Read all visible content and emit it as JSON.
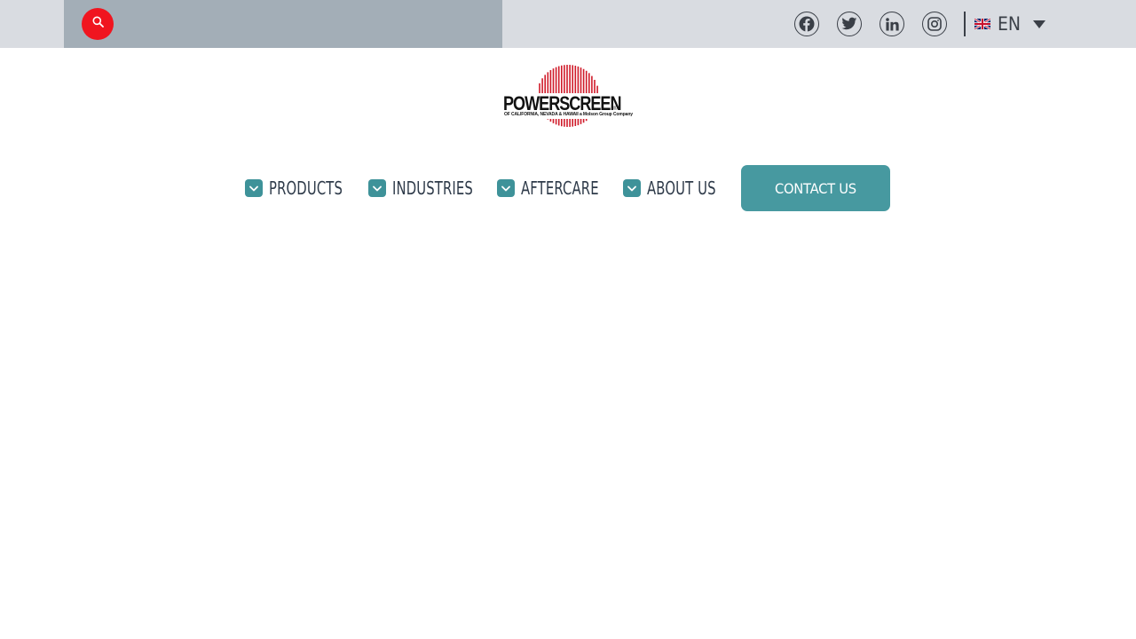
{
  "topbar": {
    "search": {
      "icon": "search-icon",
      "color": "#f0151f"
    },
    "social": [
      {
        "name": "facebook",
        "icon": "facebook-icon"
      },
      {
        "name": "twitter",
        "icon": "twitter-icon"
      },
      {
        "name": "linkedin",
        "icon": "linkedin-icon"
      },
      {
        "name": "instagram",
        "icon": "instagram-icon"
      }
    ],
    "language": {
      "flag_icon": "uk-flag-icon",
      "code": "EN",
      "caret_icon": "caret-down-icon"
    }
  },
  "logo": {
    "title": "POWERSCREEN",
    "registered": "®",
    "subtitle": "OF CALIFORNIA, NEVADA & HAWAII a Molson Group Company",
    "accent": "#d01b2a"
  },
  "nav": {
    "items": [
      {
        "label": "PRODUCTS",
        "icon": "chevron-down-icon"
      },
      {
        "label": "INDUSTRIES",
        "icon": "chevron-down-icon"
      },
      {
        "label": "AFTERCARE",
        "icon": "chevron-down-icon"
      },
      {
        "label": "ABOUT US",
        "icon": "chevron-down-icon"
      }
    ],
    "contact_label": "CONTACT US",
    "accent": "#4799a0"
  }
}
